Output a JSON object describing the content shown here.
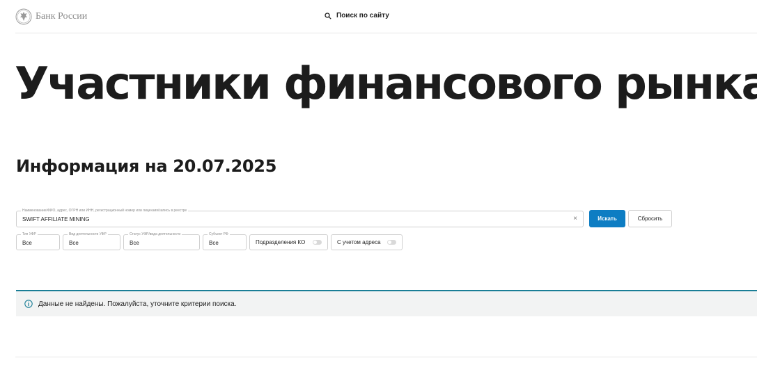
{
  "header": {
    "logo_text": "Банк России",
    "search_label": "Поиск по сайту"
  },
  "page": {
    "title": "Участники финансового рынка",
    "subtitle": "Информация на 20.07.2025"
  },
  "search": {
    "label": "Наименование/ФИО, адрес, ОГРН или ИНН, регистрационный номер или лицензия/запись в реестре",
    "value": "SWIFT AFFILIATE MINING",
    "clear_symbol": "×",
    "submit_label": "Искать",
    "reset_label": "Сбросить"
  },
  "filters": [
    {
      "label": "Тип УФР",
      "value": "Все"
    },
    {
      "label": "Вид деятельности УФР",
      "value": "Все"
    },
    {
      "label": "Статус УФР/вида деятельности",
      "value": "Все"
    },
    {
      "label": "Субъект РФ",
      "value": "Все"
    }
  ],
  "toggles": [
    {
      "label": "Подразделения КО",
      "on": false
    },
    {
      "label": "С учетом адреса",
      "on": false
    }
  ],
  "notice": {
    "text": "Данные не найдены. Пожалуйста, уточните критерии поиска.",
    "accent_color": "#1a7e96"
  },
  "colors": {
    "primary_button": "#0d7dc3"
  },
  "icons": {
    "logo": "bank-emblem-icon",
    "search": "search-icon",
    "info": "info-icon"
  }
}
